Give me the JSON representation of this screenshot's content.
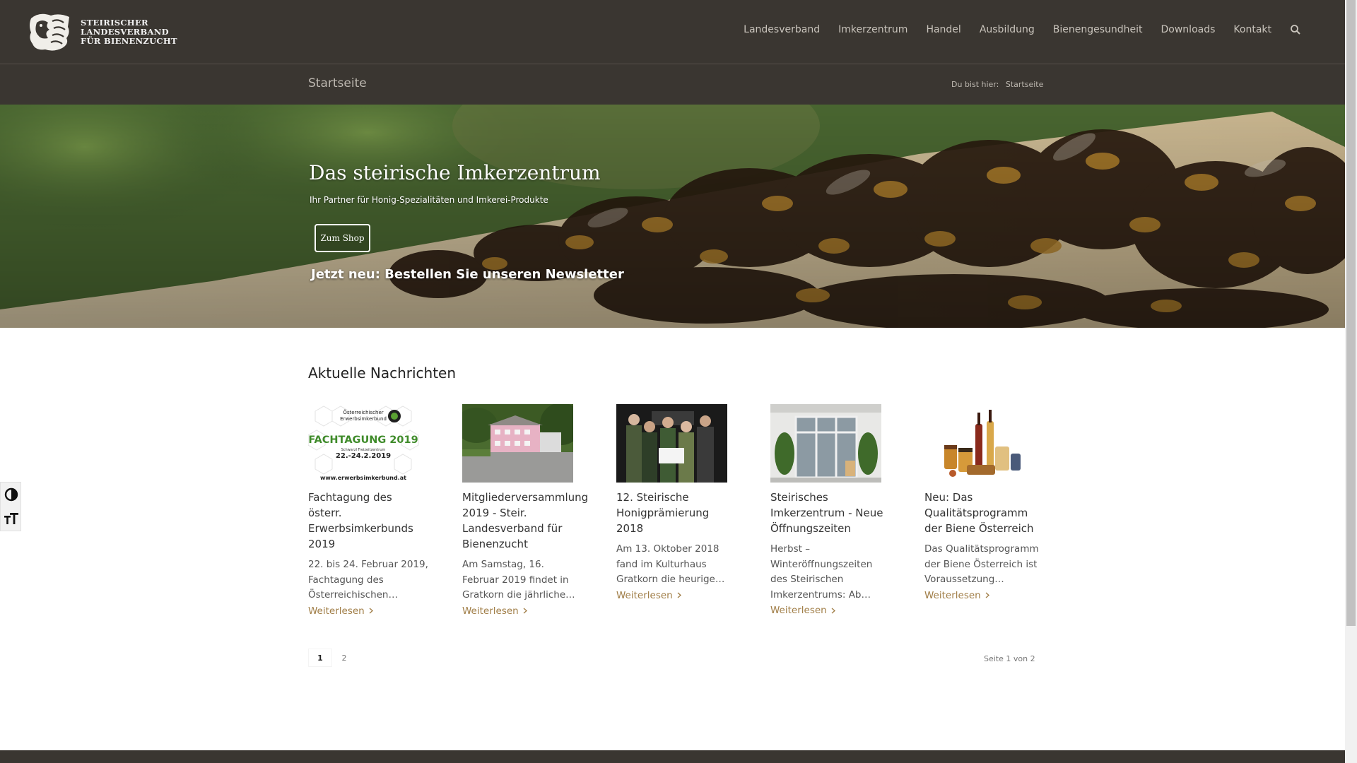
{
  "brand": {
    "line1": "STEIRISCHER",
    "line2": "LANDESVERBAND",
    "line3": "FÜR BIENENZUCHT"
  },
  "nav": {
    "items": [
      {
        "label": "Landesverband"
      },
      {
        "label": "Imkerzentrum"
      },
      {
        "label": "Handel"
      },
      {
        "label": "Ausbildung"
      },
      {
        "label": "Bienengesundheit"
      },
      {
        "label": "Downloads"
      },
      {
        "label": "Kontakt"
      }
    ],
    "search_icon": "search-icon"
  },
  "subbar": {
    "title": "Startseite",
    "crumb_prefix": "Du bist hier:",
    "crumb_current": "Startseite"
  },
  "hero": {
    "title": "Das steirische Imkerzentrum",
    "subtitle": "Ihr Partner für Honig-Spezialitäten und Imkerei-Produkte",
    "button": "Zum Shop",
    "newsletter": "Jetzt neu: Bestellen Sie unseren Newsletter"
  },
  "news": {
    "heading": "Aktuelle Nachrichten",
    "more_label": "Weiterlesen",
    "thumb1": {
      "line1": "Österreichischer",
      "line2": "Erwerbsimkerbund",
      "title": "FACHTAGUNG 2019",
      "venue": "Schwarzl Freizeitzentrum",
      "dates": "22.-24.2.2019",
      "url": "www.erwerbsimkerbund.at"
    },
    "items": [
      {
        "title": "Fachtagung des österr. Erwerbsimkerbunds 2019",
        "excerpt": "22. bis 24. Februar 2019, Fachtagung des Österreichischen…"
      },
      {
        "title": "Mitgliederversammlung 2019 - Steir. Landesverband für Bienenzucht",
        "excerpt": "Am Samstag, 16. Februar 2019 findet in Gratkorn die jährliche…"
      },
      {
        "title": "12. Steirische Honigprämierung 2018",
        "excerpt": " Am 13. Oktober 2018 fand im Kulturhaus Gratkorn die heurige…"
      },
      {
        "title": "Steirisches Imkerzentrum - Neue Öffnungszeiten",
        "excerpt": "Herbst – Winteröffnungszeiten des Steirischen Imkerzentrums: Ab…"
      },
      {
        "title": "Neu: Das Qualitätsprogramm der Biene Österreich",
        "excerpt": "Das Qualitätsprogramm der Biene Österreich ist Voraussetzung…"
      }
    ]
  },
  "pagination": {
    "pages": [
      "1",
      "2"
    ],
    "count": "Seite 1 von 2"
  },
  "colors": {
    "header_bg": "#3a3631",
    "link_accent": "#a07d46"
  }
}
